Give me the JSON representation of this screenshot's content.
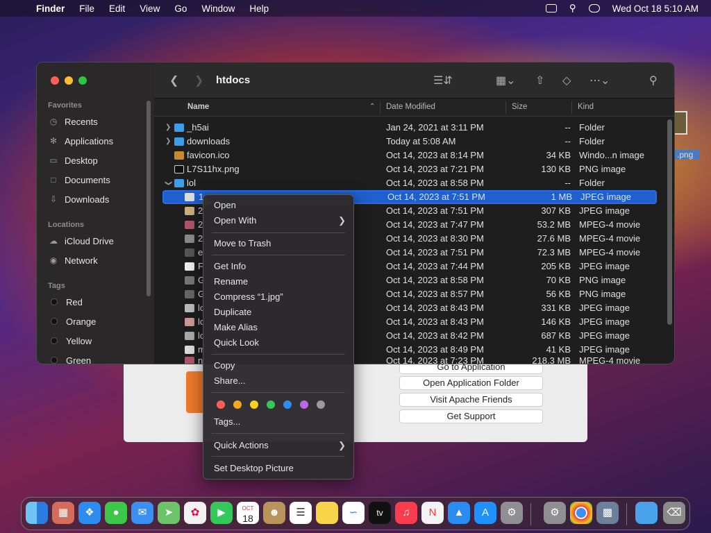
{
  "menubar": {
    "app": "Finder",
    "items": [
      "File",
      "Edit",
      "View",
      "Go",
      "Window",
      "Help"
    ],
    "clock": "Wed Oct 18  5:10 AM"
  },
  "xampp": {
    "buttons": [
      "Go to Application",
      "Open Application Folder",
      "Visit Apache Friends",
      "Get Support"
    ]
  },
  "desktop": {
    "file_label": ".png"
  },
  "finder": {
    "title": "htdocs",
    "sidebar": {
      "favorites_header": "Favorites",
      "favorites": [
        "Recents",
        "Applications",
        "Desktop",
        "Documents",
        "Downloads"
      ],
      "locations_header": "Locations",
      "locations": [
        "iCloud Drive",
        "Network"
      ],
      "tags_header": "Tags",
      "tags": [
        "Red",
        "Orange",
        "Yellow",
        "Green"
      ]
    },
    "columns": {
      "name": "Name",
      "date": "Date Modified",
      "size": "Size",
      "kind": "Kind"
    },
    "rows": [
      {
        "name": "_h5ai",
        "date": "Jan 24, 2021 at 3:11 PM",
        "size": "--",
        "kind": "Folder"
      },
      {
        "name": "downloads",
        "date": "Today at 5:08 AM",
        "size": "--",
        "kind": "Folder"
      },
      {
        "name": "favicon.ico",
        "date": "Oct 14, 2023 at 8:14 PM",
        "size": "34 KB",
        "kind": "Windo...n image"
      },
      {
        "name": "L7S11hx.png",
        "date": "Oct 14, 2023 at 7:21 PM",
        "size": "130 KB",
        "kind": "PNG image"
      },
      {
        "name": "lol",
        "date": "Oct 14, 2023 at 8:58 PM",
        "size": "--",
        "kind": "Folder"
      },
      {
        "name": "1",
        "date": "Oct 14, 2023 at 7:51 PM",
        "size": "1 MB",
        "kind": "JPEG image"
      },
      {
        "name": "2",
        "date": "Oct 14, 2023 at 7:51 PM",
        "size": "307 KB",
        "kind": "JPEG image"
      },
      {
        "name": "2",
        "date": "Oct 14, 2023 at 7:47 PM",
        "size": "53.2 MB",
        "kind": "MPEG-4 movie"
      },
      {
        "name": "2",
        "date": "Oct 14, 2023 at 8:30 PM",
        "size": "27.6 MB",
        "kind": "MPEG-4 movie"
      },
      {
        "name": "e",
        "date": "Oct 14, 2023 at 7:51 PM",
        "size": "72.3 MB",
        "kind": "MPEG-4 movie"
      },
      {
        "name": "F",
        "date": "Oct 14, 2023 at 7:44 PM",
        "size": "205 KB",
        "kind": "JPEG image"
      },
      {
        "name": "G",
        "date": "Oct 14, 2023 at 8:58 PM",
        "size": "70 KB",
        "kind": "PNG image"
      },
      {
        "name": "G",
        "date": "Oct 14, 2023 at 8:57 PM",
        "size": "56 KB",
        "kind": "PNG image"
      },
      {
        "name": "lc",
        "date": "Oct 14, 2023 at 8:43 PM",
        "size": "331 KB",
        "kind": "JPEG image"
      },
      {
        "name": "lc",
        "date": "Oct 14, 2023 at 8:43 PM",
        "size": "146 KB",
        "kind": "JPEG image"
      },
      {
        "name": "lc",
        "date": "Oct 14, 2023 at 8:42 PM",
        "size": "687 KB",
        "kind": "JPEG image"
      },
      {
        "name": "m",
        "date": "Oct 14, 2023 at 8:49 PM",
        "size": "41 KB",
        "kind": "JPEG image"
      },
      {
        "name": "n",
        "date": "Oct 14, 2023 at 7:23 PM",
        "size": "218.3 MB",
        "kind": "MPEG-4 movie"
      }
    ]
  },
  "context_menu": {
    "open": "Open",
    "open_with": "Open With",
    "move_to_trash": "Move to Trash",
    "get_info": "Get Info",
    "rename": "Rename",
    "compress": "Compress “1.jpg”",
    "duplicate": "Duplicate",
    "make_alias": "Make Alias",
    "quick_look": "Quick Look",
    "copy": "Copy",
    "share": "Share...",
    "tag_colors": [
      "#ff5f57",
      "#f5a623",
      "#f8d21c",
      "#34c759",
      "#2f8cf5",
      "#b966e8",
      "#9a9a9a"
    ],
    "tags": "Tags...",
    "quick_actions": "Quick Actions",
    "set_desktop_picture": "Set Desktop Picture"
  },
  "dock": {
    "calendar_month": "OCT",
    "calendar_day": "18",
    "tv_label": "tv"
  }
}
